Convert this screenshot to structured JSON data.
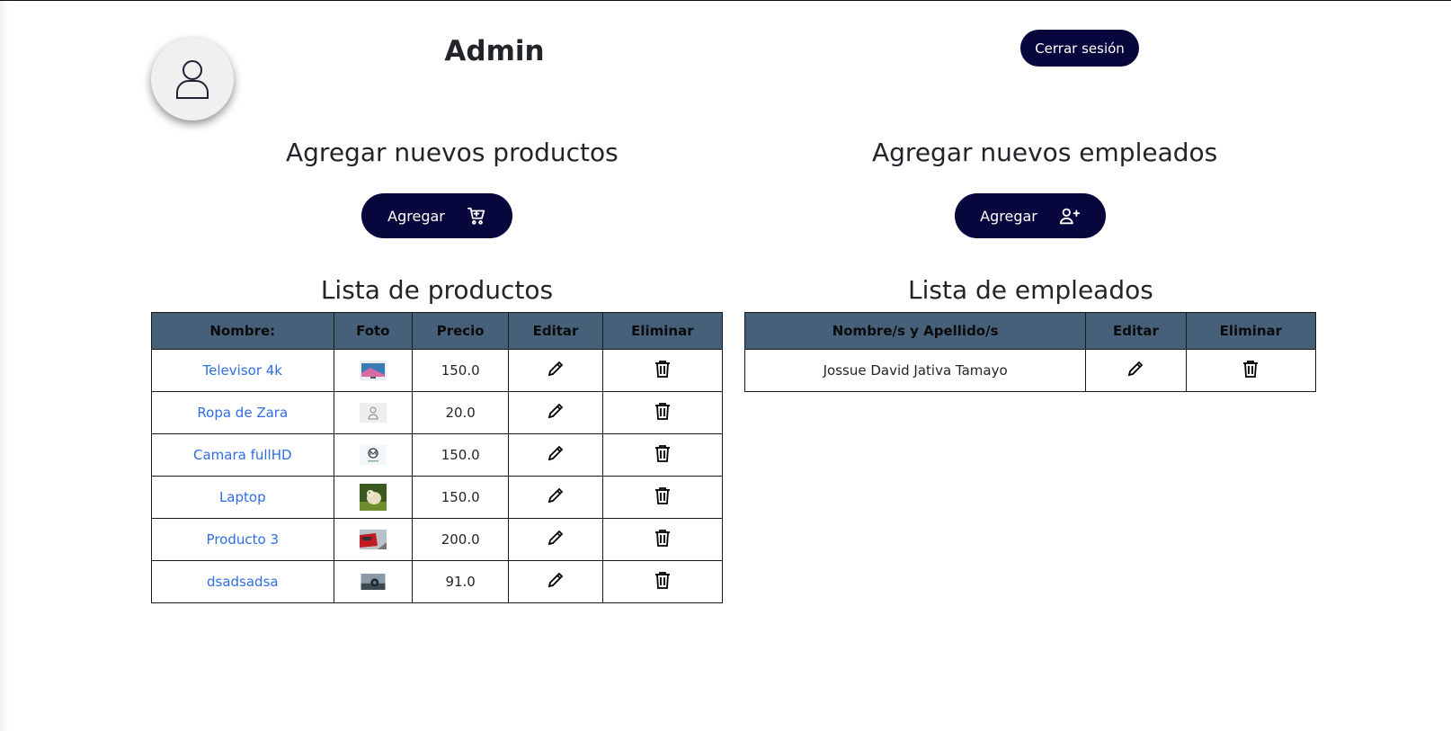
{
  "header": {
    "title": "Admin",
    "logout_label": "Cerrar sesión",
    "avatar_icon": "person-icon"
  },
  "products_section": {
    "title": "Agregar nuevos productos",
    "add_label": "Agregar",
    "add_icon": "cart-icon",
    "list_title": "Lista de productos",
    "columns": [
      "Nombre:",
      "Foto",
      "Precio",
      "Editar",
      "Eliminar"
    ],
    "rows": [
      {
        "name": "Televisor 4k",
        "photo": "tv-thumbnail",
        "price": "150.0"
      },
      {
        "name": "Ropa de Zara",
        "photo": "placeholder-person-thumbnail",
        "price": "20.0"
      },
      {
        "name": "Camara fullHD",
        "photo": "logo-thumbnail",
        "price": "150.0"
      },
      {
        "name": "Laptop",
        "photo": "dog-photo-thumbnail",
        "price": "150.0"
      },
      {
        "name": "Producto 3",
        "photo": "red-train-thumbnail",
        "price": "200.0"
      },
      {
        "name": "dsadsadsa",
        "photo": "landscape-thumbnail",
        "price": "91.0"
      }
    ]
  },
  "employees_section": {
    "title": "Agregar nuevos empleados",
    "add_label": "Agregar",
    "add_icon": "person-plus-icon",
    "list_title": "Lista de empleados",
    "columns": [
      "Nombre/s y Apellido/s",
      "Editar",
      "Eliminar"
    ],
    "rows": [
      {
        "name": "Jossue David Jativa Tamayo"
      }
    ]
  },
  "colors": {
    "button_bg": "#07073d",
    "table_header_bg": "#46607a",
    "link": "#2f6ee0"
  }
}
